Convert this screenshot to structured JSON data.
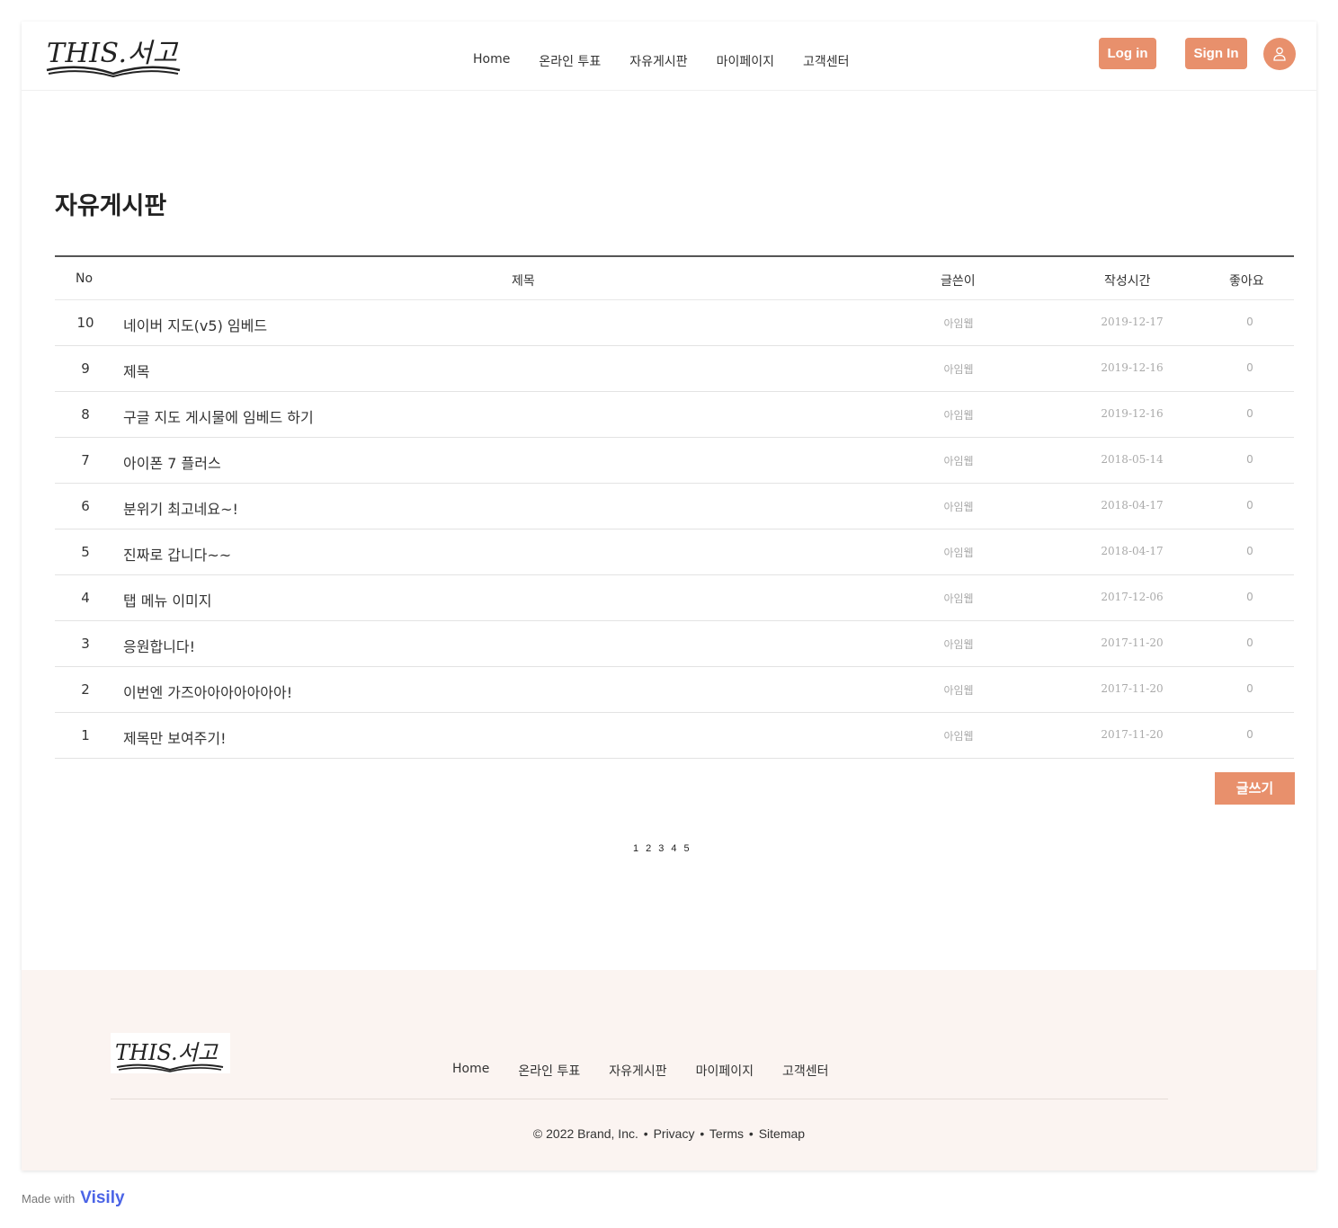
{
  "header": {
    "logo_text": "THIS.서고",
    "nav": [
      "Home",
      "온라인 투표",
      "자유게시판",
      "마이페이지",
      "고객센터"
    ],
    "login_label": "Log in",
    "signin_label": "Sign In"
  },
  "board": {
    "title": "자유게시판",
    "columns": {
      "no": "No",
      "title": "제목",
      "author": "글쓴이",
      "date": "작성시간",
      "likes": "좋아요"
    },
    "rows": [
      {
        "no": "10",
        "title": "네이버 지도(v5) 임베드",
        "author": "아임웹",
        "date": "2019-12-17",
        "likes": "0"
      },
      {
        "no": "9",
        "title": "제목",
        "author": "아임웹",
        "date": "2019-12-16",
        "likes": "0"
      },
      {
        "no": "8",
        "title": "구글 지도 게시물에 임베드 하기",
        "author": "아임웹",
        "date": "2019-12-16",
        "likes": "0"
      },
      {
        "no": "7",
        "title": "아이폰 7 플러스",
        "author": "아임웹",
        "date": "2018-05-14",
        "likes": "0"
      },
      {
        "no": "6",
        "title": "분위기 최고네요~!",
        "author": "아임웹",
        "date": "2018-04-17",
        "likes": "0"
      },
      {
        "no": "5",
        "title": "진짜로 갑니다~~",
        "author": "아임웹",
        "date": "2018-04-17",
        "likes": "0"
      },
      {
        "no": "4",
        "title": "탭 메뉴 이미지",
        "author": "아임웹",
        "date": "2017-12-06",
        "likes": "0"
      },
      {
        "no": "3",
        "title": "응원합니다!",
        "author": "아임웹",
        "date": "2017-11-20",
        "likes": "0"
      },
      {
        "no": "2",
        "title": "이번엔 가즈아아아아아아아!",
        "author": "아임웹",
        "date": "2017-11-20",
        "likes": "0"
      },
      {
        "no": "1",
        "title": "제목만 보여주기!",
        "author": "아임웹",
        "date": "2017-11-20",
        "likes": "0"
      }
    ],
    "write_label": "글쓰기",
    "pages": [
      "1",
      "2",
      "3",
      "4",
      "5"
    ]
  },
  "footer": {
    "logo_text": "THIS.서고",
    "nav": [
      "Home",
      "온라인 투표",
      "자유게시판",
      "마이페이지",
      "고객센터"
    ],
    "copyright": "© 2022 Brand, Inc.",
    "links": [
      "Privacy",
      "Terms",
      "Sitemap"
    ],
    "separator": "•"
  },
  "badge": {
    "label": "Made with",
    "brand": "Visily"
  },
  "colors": {
    "accent": "#e8906c",
    "footer_bg": "#fbf4f1",
    "brand_blue": "#4b64e6"
  },
  "icons": {
    "avatar": "user-icon",
    "logo": "open-book-icon"
  }
}
